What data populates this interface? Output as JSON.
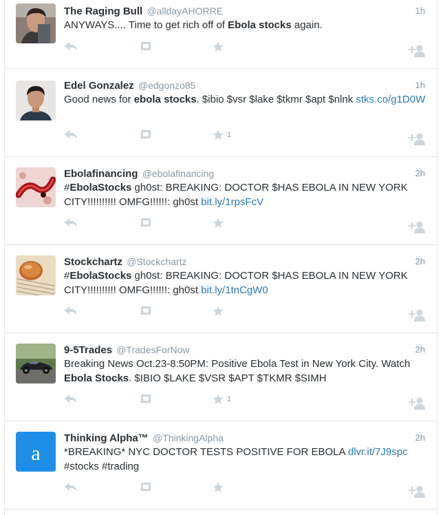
{
  "tweets": [
    {
      "fullname": "The Raging Bull",
      "handle": "@alldayAHORRE",
      "time": "1h",
      "text": [
        {
          "t": "ANYWAYS.... Time to get rich off of "
        },
        {
          "t": "Ebola stocks",
          "bold": true
        },
        {
          "t": " again."
        }
      ],
      "favorite_count": "",
      "avatar_icon": "man-selfie-avatar"
    },
    {
      "fullname": "Edel Gonzalez",
      "handle": "@edgonzo85",
      "time": "1h",
      "text": [
        {
          "t": "Good news for "
        },
        {
          "t": "ebola stocks",
          "bold": true
        },
        {
          "t": ". $ibio $vsr $lake $tkmr $apt $nlnk "
        },
        {
          "t": "stks.co/​g1D0W",
          "link": true
        }
      ],
      "favorite_count": "1",
      "avatar_icon": "man-portrait-avatar"
    },
    {
      "fullname": "Ebolafinancing",
      "handle": "@ebolafinancing",
      "time": "2h",
      "text": [
        {
          "t": "#"
        },
        {
          "t": "EbolaStocks",
          "bold": true
        },
        {
          "t": " gh0st: BREAKING: DOCTOR $HAS EBOLA IN NEW YORK CITY!!!!!!!!!! OMFG!!!!!!: gh0st "
        },
        {
          "t": "bit.ly/1rpsFcV",
          "link": true
        }
      ],
      "favorite_count": "",
      "avatar_icon": "virus-avatar"
    },
    {
      "fullname": "Stockchartz",
      "handle": "@Stockchartz",
      "time": "2h",
      "text": [
        {
          "t": "#"
        },
        {
          "t": "EbolaStocks",
          "bold": true
        },
        {
          "t": " gh0st: BREAKING: DOCTOR $HAS EBOLA IN NEW YORK CITY!!!!!!!!!! OMFG!!!!!!: gh0st "
        },
        {
          "t": "bit.ly/1tnCgW0",
          "link": true
        }
      ],
      "favorite_count": "",
      "avatar_icon": "coin-on-newspaper-avatar"
    },
    {
      "fullname": "9-5Trades",
      "handle": "@TradesForNow",
      "time": "2h",
      "text": [
        {
          "t": "Breaking News Oct.23-8:50PM: Positive Ebola Test in New York City. Watch "
        },
        {
          "t": "Ebola Stocks",
          "bold": true
        },
        {
          "t": ". $IBIO $LAKE $VSR $APT $TKMR $SIMH"
        }
      ],
      "favorite_count": "1",
      "avatar_icon": "sports-car-avatar"
    },
    {
      "fullname": "Thinking Alpha™",
      "handle": "@ThinkingAlpha",
      "time": "2h",
      "text": [
        {
          "t": "*BREAKING* NYC DOCTOR TESTS POSITIVE FOR EBOLA "
        },
        {
          "t": "dlvr.it/7J9spc",
          "link": true
        },
        {
          "t": " #stocks #trading"
        }
      ],
      "favorite_count": "",
      "avatar_icon": "letter-a-avatar",
      "avatar_letter": "a"
    }
  ],
  "icons": {
    "reply": "reply-icon",
    "retweet": "retweet-icon",
    "favorite": "star-icon",
    "follow": "follow-user-icon"
  },
  "colors": {
    "link": "#2b7bb9",
    "meta": "#8899a6",
    "action_icon": "#ccd6dd",
    "divider": "#e1e8ed",
    "alpha_blue": "#1f8ee8"
  }
}
